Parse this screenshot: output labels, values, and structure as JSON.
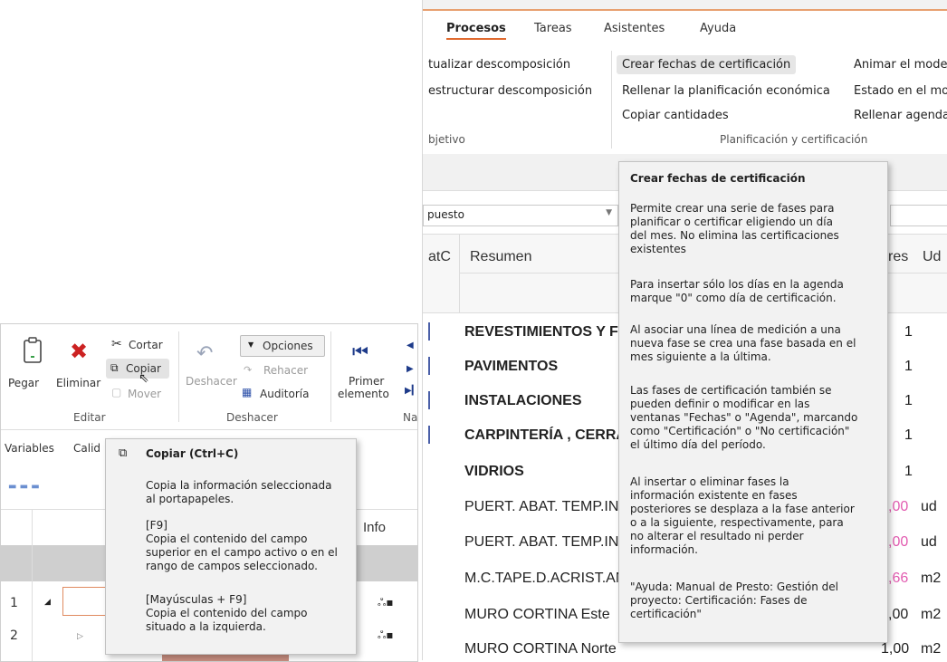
{
  "right_window": {
    "tabs": [
      "Procesos",
      "Tareas",
      "Asistentes",
      "Ayuda"
    ],
    "active_tab": "Procesos",
    "ribbon": {
      "col1": [
        "tualizar descomposición",
        "estructurar descomposición",
        "bjetivo"
      ],
      "col2": [
        "Crear fechas de certificación",
        "Rellenar la planificación económica",
        "Copiar cantidades"
      ],
      "col3": [
        "Animar el mode",
        "Estado en el mo",
        "Rellenar agenda"
      ],
      "group_label": "Planificación y certificación"
    },
    "combo_value": "puesto",
    "columns": {
      "c1": "atC",
      "c2": "Resumen",
      "c3": "res",
      "c4": "Ud"
    },
    "rows": [
      {
        "name": "REVESTIMIENTOS Y F",
        "value": "1",
        "unit": ""
      },
      {
        "name": "PAVIMENTOS",
        "value": "1",
        "unit": ""
      },
      {
        "name": "INSTALACIONES",
        "value": "1",
        "unit": ""
      },
      {
        "name": "CARPINTERÍA , CERRA",
        "value": "1",
        "unit": ""
      },
      {
        "name": "VIDRIOS",
        "value": "1",
        "unit": ""
      },
      {
        "name": "PUERT. ABAT. TEMP.IN",
        "value": ",00",
        "unit": "ud"
      },
      {
        "name": "PUERT. ABAT. TEMP.IN",
        "value": ",00",
        "unit": "ud"
      },
      {
        "name": "M.C.TAPE.D.ACRIST.AN",
        "value": ",66",
        "unit": "m2"
      },
      {
        "name": "MURO CORTINA Este",
        "value": ",00",
        "unit": "m2"
      },
      {
        "name": "MURO CORTINA Norte",
        "value": "1,00",
        "unit": "m2"
      }
    ],
    "tooltip": {
      "title": "Crear fechas de certificación",
      "paragraphs": [
        "Permite crear una serie de fases para\nplanificar o certificar eligiendo un día\ndel mes. No elimina las certificaciones\nexistentes",
        "Para insertar sólo los días en la agenda\nmarque \"0\" como día de certificación.",
        "Al asociar una línea de medición a una\nnueva fase se crea una fase basada en el\nmes siguiente a la última.",
        "Las fases de certificación también se\npueden definir o modificar en las\nventanas \"Fechas\" o \"Agenda\", marcando\ncomo \"Certificación\" o \"No certificación\"\nel último día del período.",
        "Al insertar o eliminar fases la\ninformación existente en fases\nposteriores se desplaza a la fase anterior\no a la siguiente, respectivamente, para\nno alterar el resultado ni perder\ninformación.",
        "\"Ayuda: Manual de Presto: Gestión del\nproyecto: Certificación: Fases de\ncertificación\""
      ]
    }
  },
  "left_window": {
    "ribbon": {
      "pegar": "Pegar",
      "eliminar": "Eliminar",
      "cortar": "Cortar",
      "copiar": "Copiar",
      "mover": "Mover",
      "editar_group": "Editar",
      "deshacer": "Deshacer",
      "rehacer": "Rehacer",
      "opciones": "Opciones",
      "auditoria": "Auditoría",
      "deshacer_group": "Deshacer",
      "primer": "Primer",
      "elemento": "elemento",
      "na": "Na"
    },
    "tabs": [
      "Variables",
      "Calid"
    ],
    "grid": {
      "info": "Info",
      "row1": "1",
      "row2": "2"
    },
    "tooltip": {
      "title": "Copiar (Ctrl+C)",
      "paragraphs": [
        "Copia la información seleccionada\nal portapapeles.",
        "[F9]\nCopia el contenido del campo\nsuperior en el campo activo o en el\nrango de campos seleccionado.",
        "[Mayúsculas + F9]\nCopia el contenido del campo\nsituado a la izquierda."
      ]
    }
  },
  "colors": {
    "accent": "#e06a2f",
    "delete_red": "#cc2222",
    "pink_value": "#e25bb0",
    "blue_icon": "#2b4fa8"
  }
}
